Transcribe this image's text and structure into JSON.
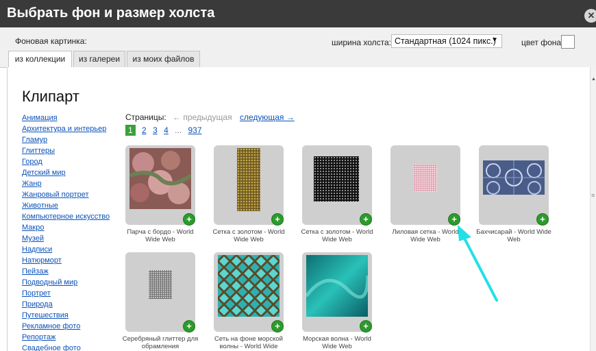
{
  "dialog": {
    "title": "Выбрать фон и размер холста",
    "close_glyph": "✕"
  },
  "top": {
    "background_label": "Фоновая картинка:",
    "width_label": "ширина холста:",
    "width_value": "Стандартная (1024 пикс.)",
    "color_label": "цвет фона:",
    "background_color": "#ffffff"
  },
  "tabs": [
    {
      "label": "из коллекции",
      "active": true
    },
    {
      "label": "из галереи",
      "active": false
    },
    {
      "label": "из моих файлов",
      "active": false
    }
  ],
  "main": {
    "title": "Клипарт",
    "categories": [
      "Анимация",
      "Архитектура и интерьер",
      "Гламур",
      "Глиттеры",
      "Город",
      "Детский мир",
      "Жанр",
      "Жанровый портрет",
      "Животные",
      "Компьютерное искусство",
      "Макро",
      "Музей",
      "Надписи",
      "Натюрморт",
      "Пейзаж",
      "Подводный мир",
      "Портрет",
      "Природа",
      "Путешествия",
      "Рекламное фото",
      "Репортаж",
      "Свадебное фото"
    ],
    "pagination": {
      "label": "Страницы:",
      "prev": "← предыдущая",
      "next": "следующая →",
      "current": "1",
      "pages": [
        "2",
        "3",
        "4"
      ],
      "dots": "...",
      "last": "937"
    },
    "items": [
      {
        "caption": "Парча с бордо - World Wide Web",
        "icon": "add-icon"
      },
      {
        "caption": "Сетка с золотом - World Wide Web",
        "icon": "add-icon"
      },
      {
        "caption": "Сетка с золотом - World Wide Web",
        "icon": "add-icon"
      },
      {
        "caption": "Лиловая сетка - World Wide Web",
        "icon": "add-icon"
      },
      {
        "caption": "Бахчисарай - World Wide Web",
        "icon": "add-icon"
      },
      {
        "caption": "Серебряный глиттер для обрамления",
        "icon": "add-icon"
      },
      {
        "caption": "Сеть на фоне морской волны - World Wide",
        "icon": "add-icon"
      },
      {
        "caption": "Морская волна - World Wide Web",
        "icon": "add-icon"
      }
    ],
    "add_glyph": "+"
  },
  "colors": {
    "titlebar": "#3a3a3a",
    "link": "#0b52b8",
    "accent_green": "#2d9a2d",
    "pointer_arrow": "#22e0e8"
  }
}
